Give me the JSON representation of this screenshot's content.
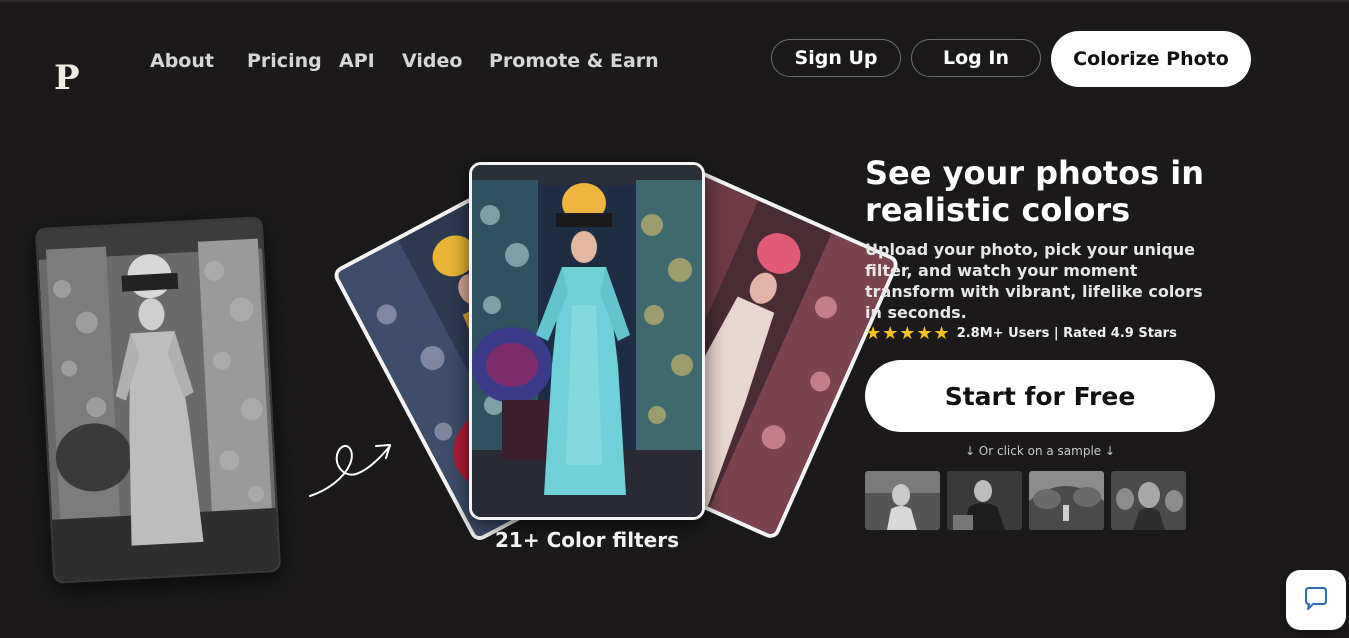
{
  "brand": {
    "logo_letter": "P"
  },
  "nav": {
    "links": [
      "About",
      "Pricing",
      "API",
      "Video",
      "Promote & Earn"
    ],
    "sign_up": "Sign Up",
    "log_in": "Log In",
    "colorize": "Colorize Photo"
  },
  "hero": {
    "title": "See your photos in realistic colors",
    "description": "Upload your photo, pick your unique filter, and watch your moment transform with vibrant, lifelike colors in seconds.",
    "stars": "★★★★★",
    "rating_value": 5,
    "rating_text": "2.8M+ Users | Rated 4.9 Stars",
    "cta": "Start for Free",
    "sample_hint": "↓ Or click on a sample ↓",
    "samples": [
      "woman-portrait-sample",
      "man-portrait-sample",
      "garden-sample",
      "mother-children-sample"
    ]
  },
  "showcase": {
    "caption": "21+ Color filters"
  },
  "colors": {
    "background": "#1b1919",
    "button_white": "#ffffff",
    "star": "#f4c21b"
  },
  "icons": {
    "chat": "chat-bubble-icon",
    "arrow": "hand-drawn-arrow-icon"
  }
}
